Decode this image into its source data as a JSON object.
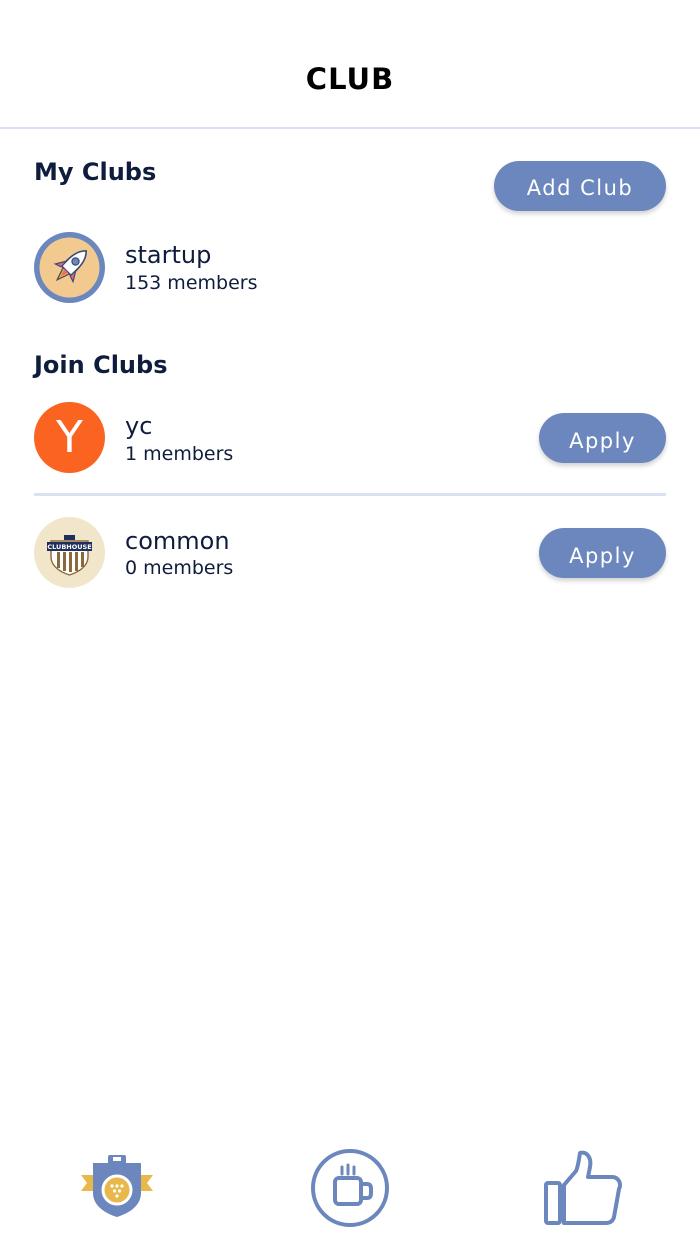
{
  "header": {
    "title": "CLUB"
  },
  "my_clubs": {
    "title": "My Clubs",
    "add_button_label": "Add Club",
    "items": [
      {
        "name": "startup",
        "members": "153 members",
        "icon": "rocket-icon"
      }
    ]
  },
  "join_clubs": {
    "title": "Join Clubs",
    "items": [
      {
        "name": "yc",
        "members": "1 members",
        "icon": "y-letter-logo",
        "apply_label": "Apply"
      },
      {
        "name": "common",
        "members": "0 members",
        "icon": "clubhouse-shield-logo",
        "apply_label": "Apply"
      }
    ]
  },
  "avatar_text": {
    "yc": "Y",
    "clubhouse": "CLUBHOUSE"
  },
  "tabbar": {
    "items": [
      {
        "icon": "club-badge-icon"
      },
      {
        "icon": "coffee-cup-icon"
      },
      {
        "icon": "thumbs-up-icon"
      }
    ]
  },
  "colors": {
    "accent": "#6b87bd",
    "divider": "#d9e1f2",
    "text_dark": "#0f1d3d",
    "yc_orange": "#fa6420",
    "gold": "#e9b84c"
  }
}
